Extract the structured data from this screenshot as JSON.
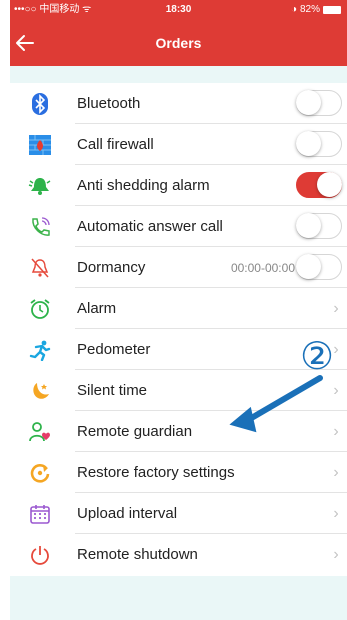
{
  "status_bar": {
    "carrier": "•••○○ 中国移动 ᯤ",
    "time": "18:30",
    "battery": "82%"
  },
  "nav": {
    "title": "Orders",
    "back_icon": "arrow-left-icon"
  },
  "accent": "#de3b35",
  "items": [
    {
      "label": "Bluetooth",
      "icon": "bluetooth-icon",
      "control": "toggle",
      "on": false
    },
    {
      "label": "Call firewall",
      "icon": "firewall-icon",
      "control": "toggle",
      "on": false
    },
    {
      "label": "Anti shedding alarm",
      "icon": "bell-alarm-icon",
      "control": "toggle",
      "on": true
    },
    {
      "label": "Automatic answer call",
      "icon": "phone-icon",
      "control": "toggle",
      "on": false
    },
    {
      "label": "Dormancy",
      "icon": "bell-off-icon",
      "control": "toggle",
      "on": false,
      "value": "00:00-00:00"
    },
    {
      "label": "Alarm",
      "icon": "alarm-clock-icon",
      "control": "chevron"
    },
    {
      "label": "Pedometer",
      "icon": "runner-icon",
      "control": "chevron"
    },
    {
      "label": "Silent time",
      "icon": "moon-icon",
      "control": "chevron"
    },
    {
      "label": "Remote guardian",
      "icon": "guardian-icon",
      "control": "chevron"
    },
    {
      "label": "Restore factory settings",
      "icon": "restore-icon",
      "control": "chevron"
    },
    {
      "label": "Upload interval",
      "icon": "calendar-icon",
      "control": "chevron"
    },
    {
      "label": "Remote shutdown",
      "icon": "power-icon",
      "control": "chevron"
    }
  ],
  "annotation": {
    "number": "②"
  }
}
